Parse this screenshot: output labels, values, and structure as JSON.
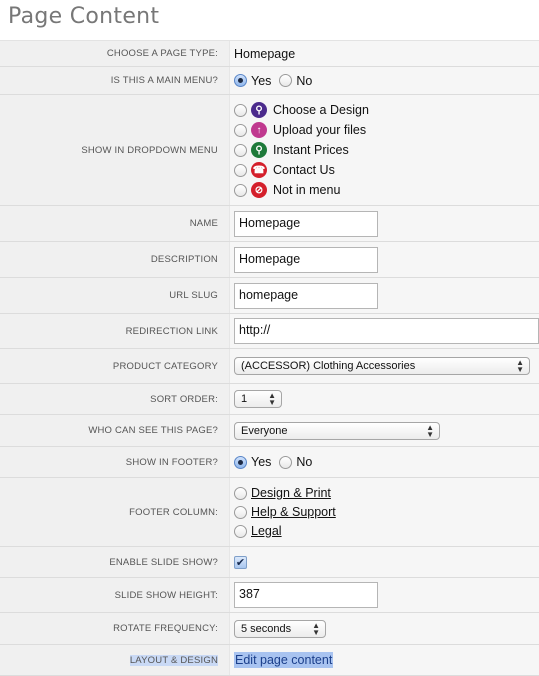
{
  "page": {
    "title": "Page Content"
  },
  "fields": {
    "page_type": {
      "label": "CHOOSE A PAGE TYPE:",
      "value": "Homepage"
    },
    "main_menu": {
      "label": "IS THIS A MAIN MENU?",
      "yes": "Yes",
      "no": "No",
      "selected": "Yes"
    },
    "dropdown_menu": {
      "label": "SHOW IN DROPDOWN MENU",
      "options": [
        {
          "label": "Choose a Design",
          "icon": "magnifier-icon"
        },
        {
          "label": "Upload your files",
          "icon": "upload-arrow-icon"
        },
        {
          "label": "Instant Prices",
          "icon": "magnifier-icon"
        },
        {
          "label": "Contact Us",
          "icon": "telephone-icon"
        },
        {
          "label": "Not in menu",
          "icon": "no-entry-icon"
        }
      ]
    },
    "name": {
      "label": "NAME",
      "value": "Homepage"
    },
    "description": {
      "label": "DESCRIPTION",
      "value": "Homepage"
    },
    "url_slug": {
      "label": "URL SLUG",
      "value": "homepage"
    },
    "redirection_link": {
      "label": "REDIRECTION LINK",
      "value": "http://"
    },
    "product_category": {
      "label": "PRODUCT CATEGORY",
      "value": "(ACCESSOR) Clothing Accessories"
    },
    "sort_order": {
      "label": "SORT ORDER:",
      "value": "1"
    },
    "visibility": {
      "label": "WHO CAN SEE THIS PAGE?",
      "value": "Everyone"
    },
    "show_in_footer": {
      "label": "SHOW IN FOOTER?",
      "yes": "Yes",
      "no": "No",
      "selected": "Yes"
    },
    "footer_column": {
      "label": "FOOTER COLUMN:",
      "options": [
        "Design & Print",
        "Help & Support",
        "Legal"
      ]
    },
    "enable_slideshow": {
      "label": "ENABLE SLIDE SHOW?",
      "checked": true,
      "check_glyph": "✔"
    },
    "slideshow_height": {
      "label": "SLIDE SHOW HEIGHT:",
      "value": "387"
    },
    "rotate_frequency": {
      "label": "ROTATE FREQUENCY:",
      "value": "5 seconds"
    },
    "layout_design": {
      "label": "LAYOUT & DESIGN",
      "link": "Edit page content"
    }
  },
  "colors": {
    "accent": "#5a86c7",
    "selection_highlight": "#a8c3f0",
    "label_text": "#555555",
    "row_background": "#f6f6f6"
  },
  "glyphs": {
    "select_arrows": "▲▼",
    "upload": "↑",
    "phone": "☎",
    "no": "⊘",
    "search": "⚲"
  }
}
